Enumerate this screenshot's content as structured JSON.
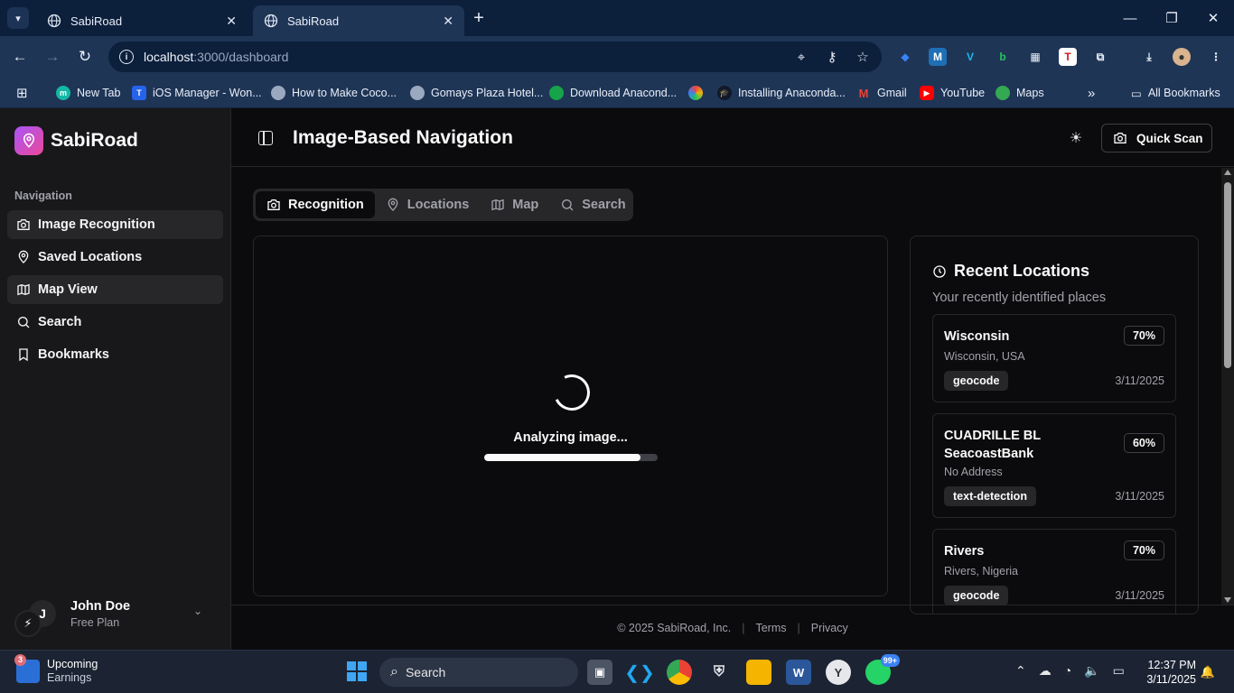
{
  "browser": {
    "tabs": [
      {
        "title": "SabiRoad",
        "active": false
      },
      {
        "title": "SabiRoad",
        "active": true
      }
    ],
    "url_host": "localhost",
    "url_path": ":3000/dashboard",
    "bookmarks": [
      {
        "label": "New Tab",
        "icon": "m-icon",
        "color": "#14b8a6"
      },
      {
        "label": "iOS Manager - Won...",
        "icon": "t-icon",
        "color": "#2563eb"
      },
      {
        "label": "How to Make Coco...",
        "icon": "globe-icon",
        "color": "#9aa9c0"
      },
      {
        "label": "Gomays Plaza Hotel...",
        "icon": "globe-icon",
        "color": "#9aa9c0"
      },
      {
        "label": "Download Anacond...",
        "icon": "anaconda-icon",
        "color": "#16a34a"
      },
      {
        "label": "",
        "icon": "pinwheel-icon",
        "color": "#eab308"
      },
      {
        "label": "Installing Anaconda...",
        "icon": "graduation-cap-icon",
        "color": "#111827"
      },
      {
        "label": "Gmail",
        "icon": "gmail-icon",
        "color": "#ea4335"
      },
      {
        "label": "YouTube",
        "icon": "youtube-icon",
        "color": "#ff0000"
      },
      {
        "label": "Maps",
        "icon": "maps-icon",
        "color": "#34a853"
      }
    ],
    "all_bookmarks": "All Bookmarks"
  },
  "app": {
    "brand": "SabiRoad",
    "nav_heading": "Navigation",
    "nav_items": [
      {
        "label": "Image Recognition",
        "icon": "camera-icon",
        "active": true
      },
      {
        "label": "Saved Locations",
        "icon": "map-pin-icon",
        "active": false
      },
      {
        "label": "Map View",
        "icon": "map-icon",
        "active": true
      },
      {
        "label": "Search",
        "icon": "search-icon",
        "active": false
      },
      {
        "label": "Bookmarks",
        "icon": "bookmark-icon",
        "active": false
      }
    ],
    "user": {
      "initial": "J",
      "name": "John Doe",
      "plan": "Free Plan"
    },
    "page_title": "Image-Based Navigation",
    "quick_scan": "Quick Scan",
    "tabs": [
      {
        "label": "Recognition",
        "icon": "camera-icon",
        "active": true
      },
      {
        "label": "Locations",
        "icon": "map-pin-icon",
        "active": false
      },
      {
        "label": "Map",
        "icon": "map-icon",
        "active": false
      },
      {
        "label": "Search",
        "icon": "search-icon",
        "active": false
      }
    ],
    "analysis": {
      "status": "Analyzing image...",
      "progress": 0.9
    },
    "recent": {
      "title": "Recent Locations",
      "subtitle": "Your recently identified places",
      "items": [
        {
          "name": "Wisconsin",
          "address": "Wisconsin, USA",
          "confidence": "70%",
          "tag": "geocode",
          "date": "3/11/2025"
        },
        {
          "name": "CUADRILLE BL SeacoastBank",
          "address": "No Address",
          "confidence": "60%",
          "tag": "text-detection",
          "date": "3/11/2025"
        },
        {
          "name": "Rivers",
          "address": "Rivers, Nigeria",
          "confidence": "70%",
          "tag": "geocode",
          "date": "3/11/2025"
        }
      ]
    },
    "footer": {
      "copyright": "© 2025 SabiRoad, Inc.",
      "terms": "Terms",
      "privacy": "Privacy"
    }
  },
  "taskbar": {
    "weather_badge": "3",
    "weather_line1": "Upcoming",
    "weather_line2": "Earnings",
    "search": "Search",
    "whatsapp_badge": "99+",
    "time": "12:37 PM",
    "date": "3/11/2025"
  }
}
